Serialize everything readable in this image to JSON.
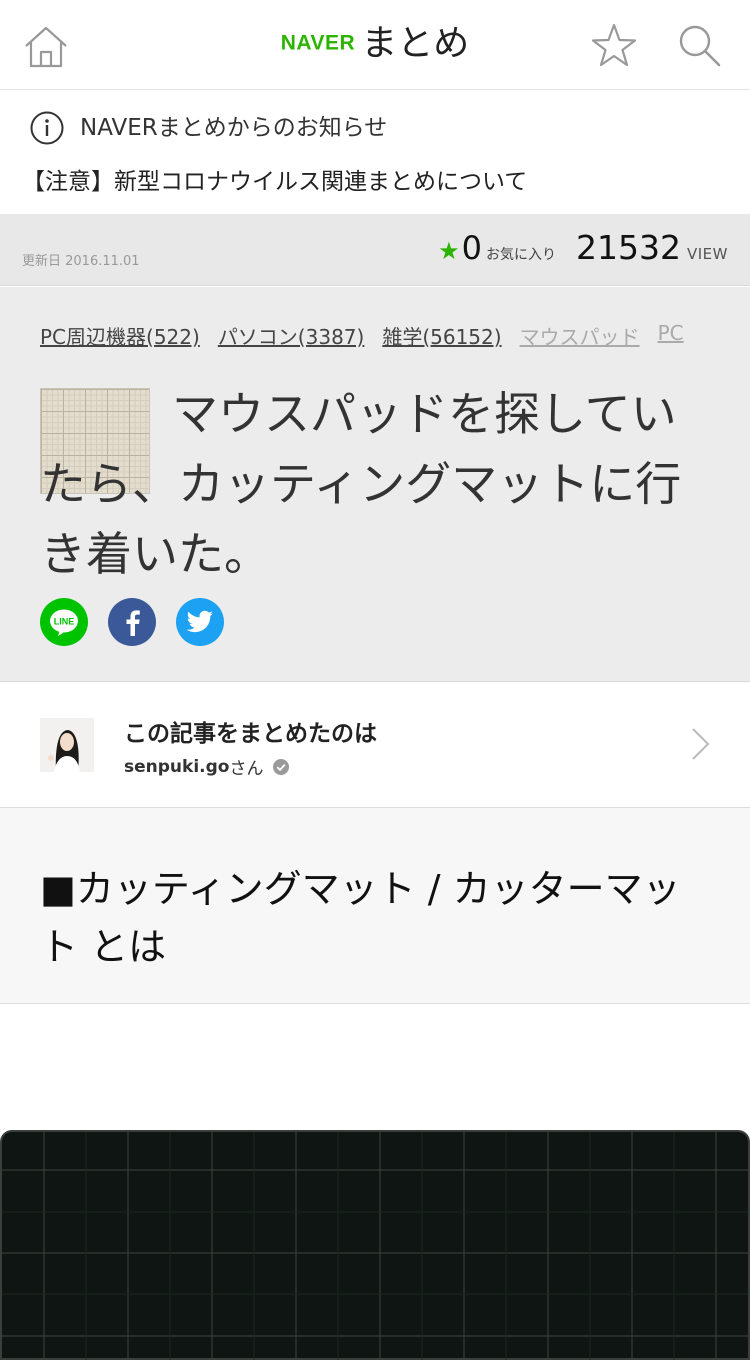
{
  "header": {
    "logo_naver": "NAVER",
    "logo_matome": "まとめ",
    "icons": [
      "home-icon",
      "star-icon",
      "search-icon"
    ]
  },
  "notice": {
    "title": "NAVERまとめからのお知らせ",
    "link": "【注意】新型コロナウイルス関連まとめについて"
  },
  "meta": {
    "updated": "更新日 2016.11.01",
    "fav_count": "0",
    "fav_label": "お気に入り",
    "view_count": "21532",
    "view_label": "VIEW"
  },
  "article": {
    "tags": [
      {
        "label": "PC周辺機器(522)"
      },
      {
        "label": "パソコン(3387)"
      },
      {
        "label": "雑学(56152)"
      },
      {
        "label": "マウスパッド"
      },
      {
        "label": "PC"
      }
    ],
    "title": "マウスパッドを探していたら、カッティングマットに行き着いた。",
    "share": {
      "line": "LINE"
    }
  },
  "author": {
    "label": "この記事をまとめたのは",
    "name": "senpuki.go",
    "suffix": "さん"
  },
  "section": {
    "heading": "■カッティングマット / カッターマット とは"
  },
  "colors": {
    "accent": "#2db400",
    "line": "#00c300",
    "facebook": "#3b5998",
    "twitter": "#1da1f2"
  }
}
